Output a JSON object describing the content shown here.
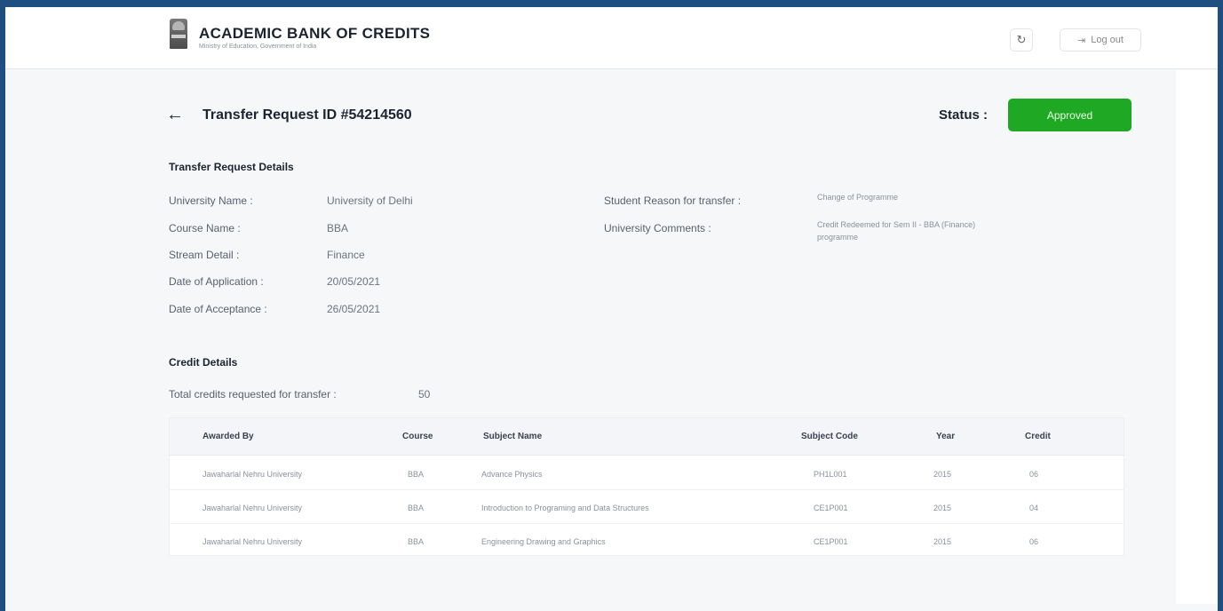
{
  "header": {
    "title": "ACADEMIC BANK OF CREDITS",
    "subtitle": "Ministry of Education, Government of India",
    "logout_label": "Log out",
    "logout_icon": "⇥",
    "refresh_icon": "↻"
  },
  "page": {
    "back_icon": "←",
    "title": "Transfer Request ID #54214560",
    "status_label": "Status :",
    "status_value": "Approved",
    "status_color": "#1fa824"
  },
  "details": {
    "section_title": "Transfer Request Details",
    "university_name_label": "University Name :",
    "university_name": "University of Delhi",
    "course_name_label": "Course Name :",
    "course_name": "BBA",
    "stream_label": "Stream Detail :",
    "stream": "Finance",
    "application_date_label": "Date of Application :",
    "application_date": "20/05/2021",
    "acceptance_date_label": "Date of Acceptance :",
    "acceptance_date": "26/05/2021",
    "reason_label": "Student Reason for transfer :",
    "reason": "Change of Programme",
    "comments_label": "University Comments :",
    "comments_line1": "Credit Redeemed for Sem II - BBA (Finance)",
    "comments_line2": "programme"
  },
  "credits": {
    "section_title": "Credit Details",
    "total_label": "Total credits requested for transfer :",
    "total_value": "50",
    "columns": [
      "Awarded By",
      "Course",
      "Subject Name",
      "Subject Code",
      "Year",
      "Credit"
    ],
    "rows": [
      [
        "Jawaharlal Nehru University",
        "BBA",
        "Advance Physics",
        "PH1L001",
        "2015",
        "06"
      ],
      [
        "Jawaharlal Nehru University",
        "BBA",
        "Introduction to Programing and Data Structures",
        "CE1P001",
        "2015",
        "04"
      ],
      [
        "Jawaharlal Nehru University",
        "BBA",
        "Engineering Drawing and Graphics",
        "CE1P001",
        "2015",
        "06"
      ]
    ]
  }
}
